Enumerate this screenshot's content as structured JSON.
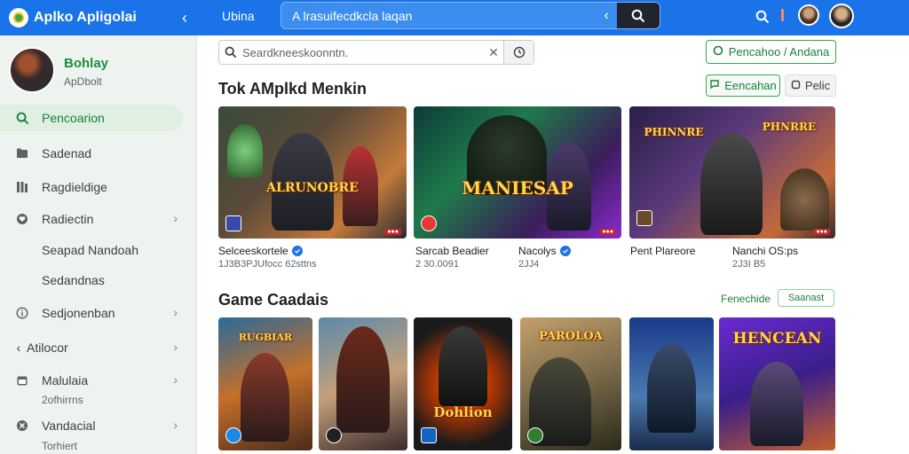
{
  "app": {
    "title": "Aplko Apligolai",
    "top_tab": "Ubina"
  },
  "top_search": {
    "value": "A lrasuifecdkcla laqan"
  },
  "colors": {
    "brand": "#1a73e8",
    "accent": "#34a853"
  },
  "sidebar": {
    "profile": {
      "name": "Bohlay",
      "sub": "ApDbolt"
    },
    "items": [
      {
        "label": "Pencoarion",
        "icon": "search-icon",
        "active": true
      },
      {
        "label": "Sadenad",
        "icon": "folder-icon"
      },
      {
        "label": "Ragdieldige",
        "icon": "library-icon"
      },
      {
        "label": "Radiectin",
        "icon": "heart-icon",
        "chevron": true
      },
      {
        "label": "Seapad Nandoah"
      },
      {
        "label": "Sedandnas"
      },
      {
        "label": "Sedjonenban",
        "icon": "info-icon",
        "chevron": true
      },
      {
        "label": "Atilocor",
        "icon": "chevron-left-icon",
        "chevron": true
      },
      {
        "label": "Malulaia",
        "sub": "2ofhirrns",
        "icon": "calendar-icon",
        "chevron": true
      },
      {
        "label": "Vandacial",
        "sub": "Torhiert",
        "icon": "close-circle-icon",
        "chevron": true
      }
    ]
  },
  "main": {
    "search": {
      "value": "Seardkneeskoonntn."
    },
    "buttons": {
      "primary": "Pencahoo / Andana",
      "filter": "Eencahan",
      "sort": "Pelic"
    },
    "section1": {
      "title": "Tok AMplkd Menkin",
      "cards": [
        {
          "art": "ALRUNOBRE",
          "name": "Selceeskortele",
          "verified": true,
          "meta": "1J3B3PJUfocc 62sttns"
        },
        {
          "art": "MANIESAP",
          "name": "Sarcab Beadier",
          "meta": "2 30.0091"
        },
        {
          "art": "",
          "name": "Nacolys",
          "verified": true,
          "meta": "2JJ4"
        },
        {
          "art": "PHINNRE",
          "name": "Pent Plareore",
          "meta": ""
        },
        {
          "art": "PHNRRE",
          "name": "Nanchi OS:ps",
          "meta": "2J3I B5"
        }
      ]
    },
    "section2": {
      "title": "Game Caadais",
      "link": "Fenechide",
      "chip": "Saanast",
      "cards": [
        {
          "art": "RUGBIAR"
        },
        {
          "art": ""
        },
        {
          "art": "Dohlion"
        },
        {
          "art": "PAROLOA"
        },
        {
          "art": ""
        },
        {
          "art": "HENCEAN"
        }
      ]
    }
  }
}
